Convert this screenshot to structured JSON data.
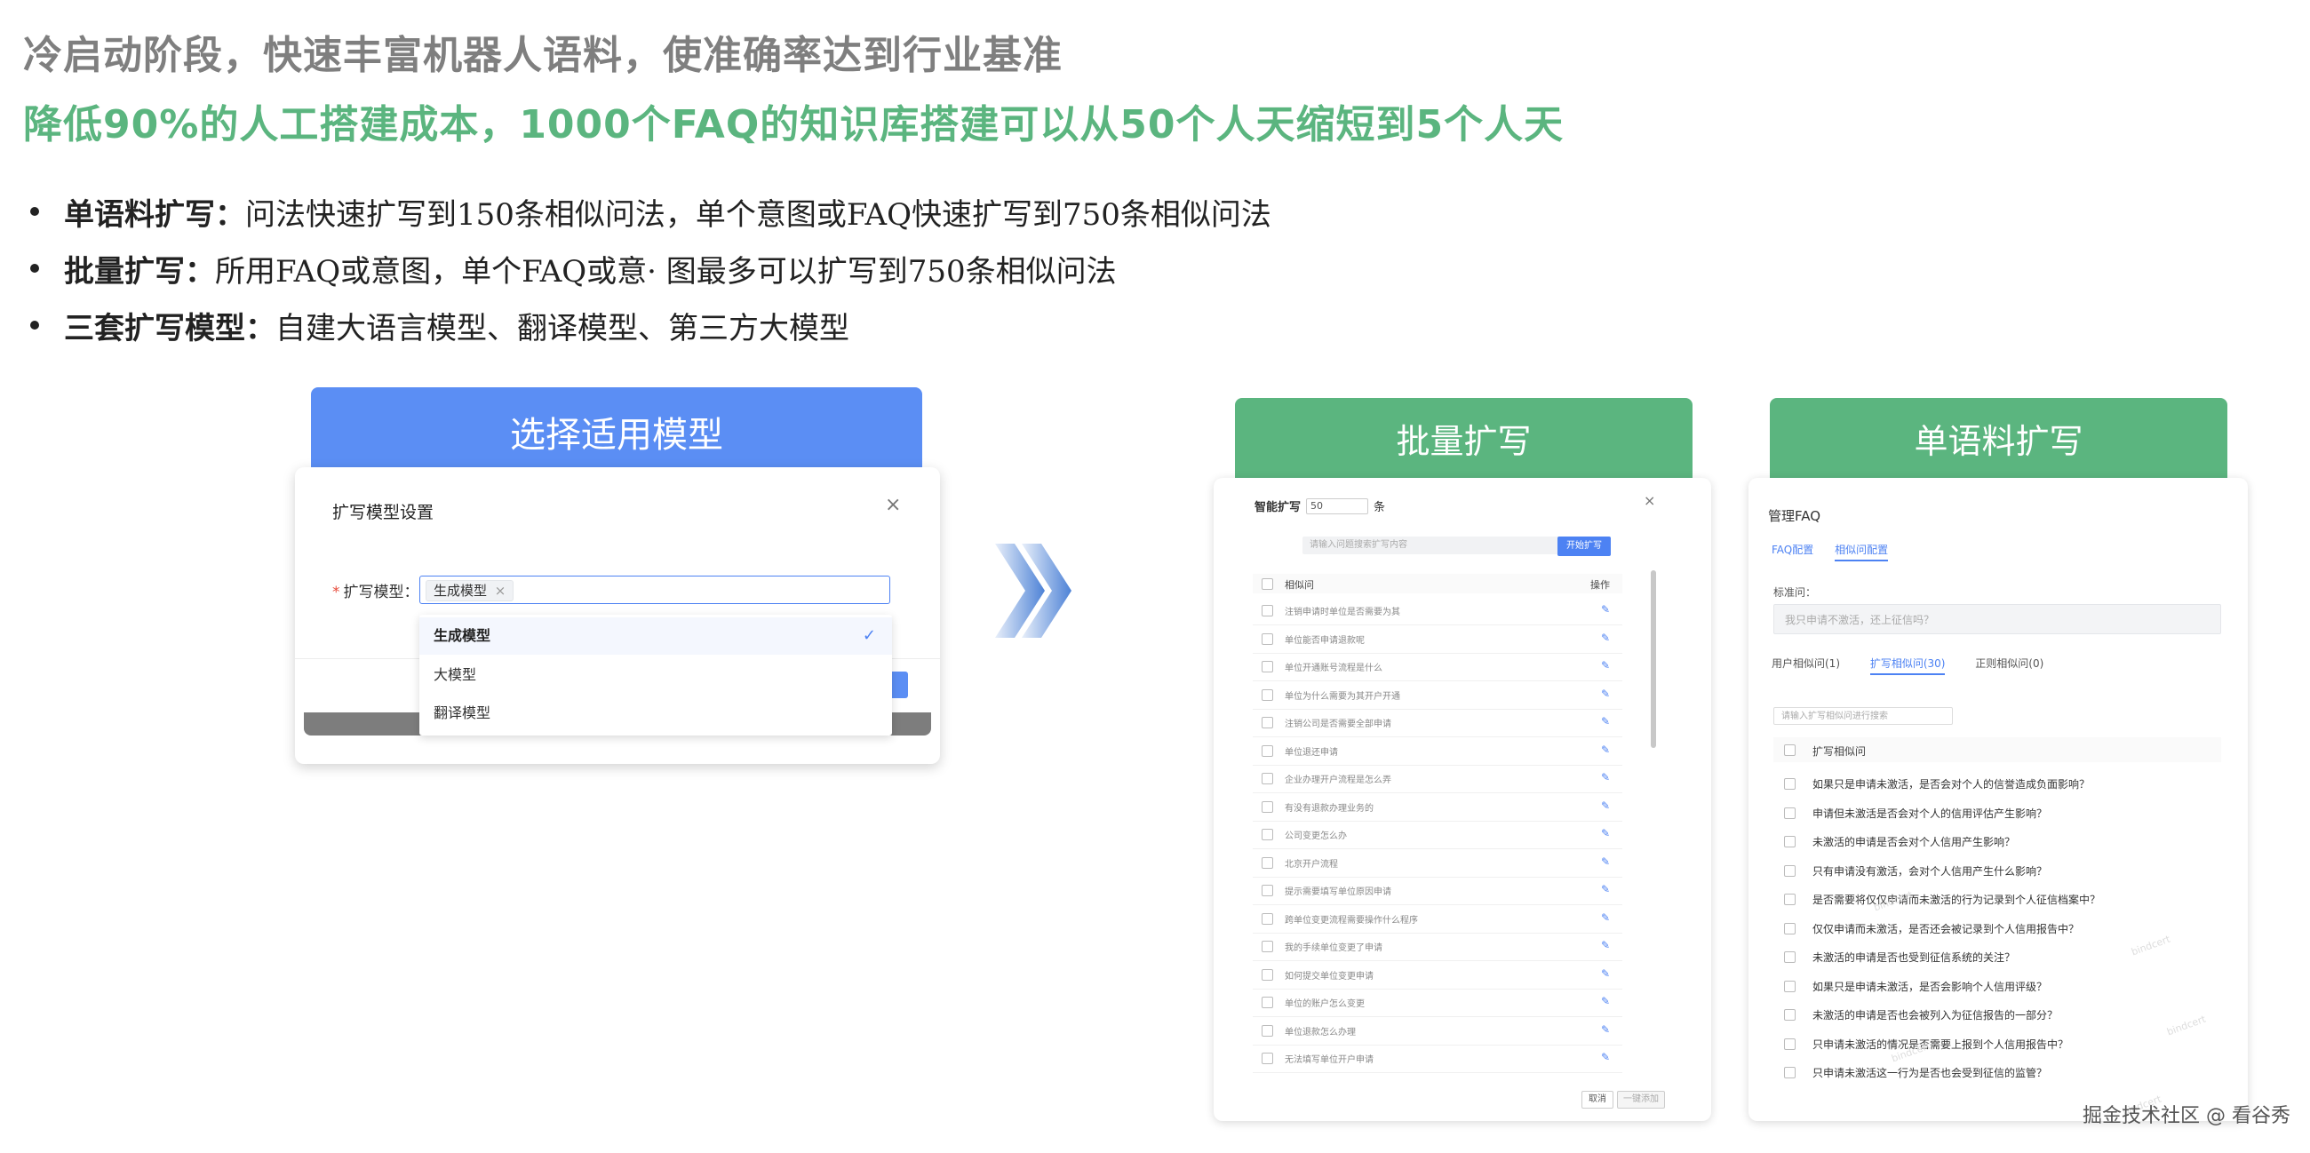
{
  "headline_1": "冷启动阶段，快速丰富机器人语料，使准确率达到行业基准",
  "headline_2": "降低90%的人工搭建成本，1000个FAQ的知识库搭建可以从50个人天缩短到5个人天",
  "bullets": [
    {
      "title": "单语料扩写：",
      "desc": "问法快速扩写到150条相似问法，单个意图或FAQ快速扩写到750条相似问法"
    },
    {
      "title": "批量扩写：",
      "desc": "所用FAQ或意图，单个FAQ或意· 图最多可以扩写到750条相似问法"
    },
    {
      "title": "三套扩写模型：",
      "desc": "自建大语言模型、翻译模型、第三方大模型"
    }
  ],
  "panel_model": {
    "banner": "选择适用模型",
    "dialog_title": "扩写模型设置",
    "close": "×",
    "field_label": "扩写模型：",
    "required_mark": "*",
    "selected_tag": "生成模型",
    "tag_close": "×",
    "options": [
      "生成模型",
      "大模型",
      "翻译模型"
    ],
    "selected_option": "生成模型",
    "check_mark": "✓"
  },
  "panel_batch": {
    "banner": "批量扩写",
    "label_prefix": "智能扩写",
    "count_value": "50",
    "label_suffix": "条",
    "close": "×",
    "search_placeholder": "请输入问题搜索扩写内容",
    "search_button": "开始扩写",
    "col_question": "相似问",
    "col_action": "操作",
    "edit_icon": "✎",
    "rows": [
      "注销申请时单位是否需要为其",
      "单位能否申请退款呢",
      "单位开通账号流程是什么",
      "单位为什么需要为其开户开通",
      "注销公司是否需要全部申请",
      "单位退还申请",
      "企业办理开户流程是怎么弄",
      "有没有退款办理业务的",
      "公司变更怎么办",
      "北京开户流程",
      "提示需要填写单位原因申请",
      "跨单位变更流程需要操作什么程序",
      "我的手续单位变更了申请",
      "如何提交单位变更申请",
      "单位的账户怎么变更",
      "单位退款怎么办理",
      "无法填写单位开户申请"
    ],
    "cancel": "取消",
    "confirm": "一键添加"
  },
  "panel_single": {
    "banner": "单语料扩写",
    "title": "管理FAQ",
    "tabs": [
      "FAQ配置",
      "相似问配置"
    ],
    "std_label": "标准问：",
    "std_value": "我只申请不激活，还上征信吗？",
    "sub_tabs": [
      "用户相似问(1)",
      "扩写相似问(30)",
      "正则相似问(0)"
    ],
    "search_placeholder": "请输入扩写相似问进行搜索",
    "col_header": "扩写相似问",
    "rows": [
      "如果只是申请未激活，是否会对个人的信誉造成负面影响？",
      "申请但未激活是否会对个人的信用评估产生影响？",
      "未激活的申请是否会对个人信用产生影响？",
      "只有申请没有激活，会对个人信用产生什么影响？",
      "是否需要将仅仅申请而未激活的行为记录到个人征信档案中？",
      "仅仅申请而未激活，是否还会被记录到个人信用报告中？",
      "未激活的申请是否也受到征信系统的关注？",
      "如果只是申请未激活，是否会影响个人信用评级？",
      "未激活的申请是否也会被列入为征信报告的一部分？",
      "只申请未激活的情况是否需要上报到个人信用报告中？",
      "只申请未激活这一行为是否也会受到征信的监管？"
    ],
    "watermark": "bindcert"
  },
  "footer": "掘金技术社区 @ 看谷秀"
}
